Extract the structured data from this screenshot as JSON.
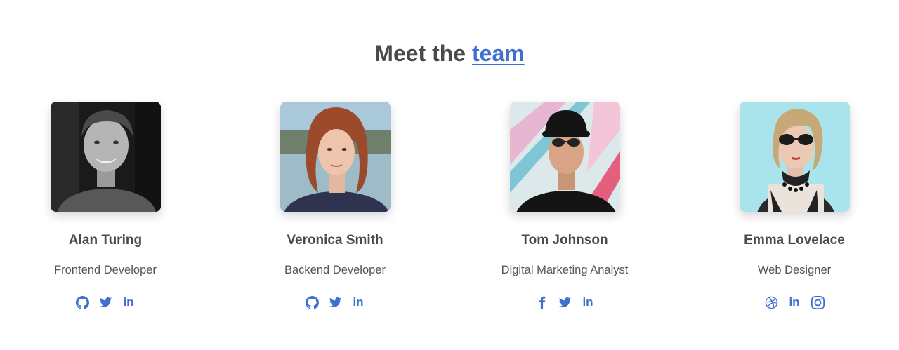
{
  "section": {
    "title_prefix": "Meet the ",
    "title_accent": "team",
    "accent_color": "#3f6fcf"
  },
  "members": [
    {
      "name": "Alan Turing",
      "role": "Frontend Developer",
      "photo": "portrait-smiling-man-bw",
      "socials": [
        "github-icon",
        "twitter-icon",
        "linkedin-icon"
      ]
    },
    {
      "name": "Veronica Smith",
      "role": "Backend Developer",
      "photo": "portrait-red-haired-woman",
      "socials": [
        "github-icon",
        "twitter-icon",
        "linkedin-icon"
      ]
    },
    {
      "name": "Tom Johnson",
      "role": "Digital Marketing Analyst",
      "photo": "portrait-man-cap-sunglasses",
      "socials": [
        "facebook-icon",
        "twitter-icon",
        "linkedin-icon"
      ]
    },
    {
      "name": "Emma Lovelace",
      "role": "Web Designer",
      "photo": "portrait-blonde-woman-sunglasses",
      "socials": [
        "dribbble-icon",
        "linkedin-icon",
        "instagram-icon"
      ]
    }
  ]
}
